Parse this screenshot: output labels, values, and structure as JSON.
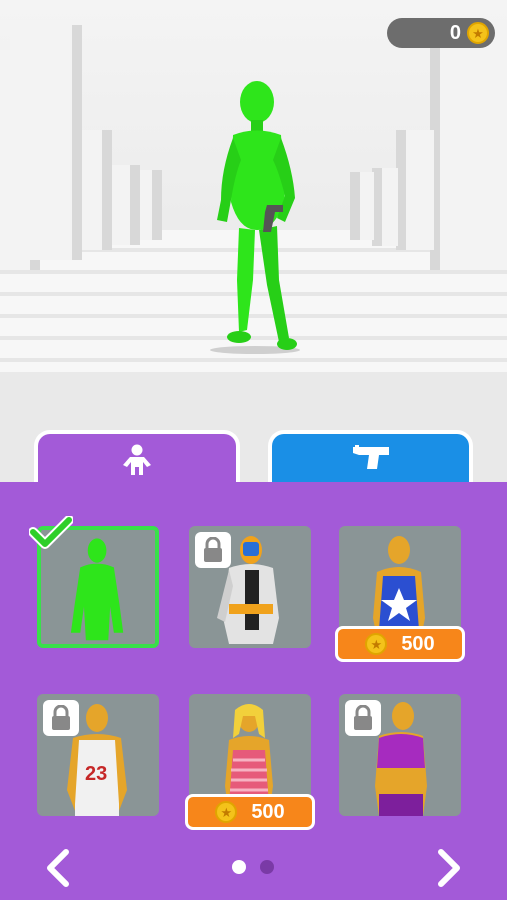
{
  "hud": {
    "coins": "0",
    "coin_icon": "coin-icon"
  },
  "tabs": [
    {
      "name": "skins",
      "icon": "person-icon",
      "active": true,
      "color": "#a35ad8"
    },
    {
      "name": "weapons",
      "icon": "pistol-icon",
      "active": false,
      "color": "#1a8fe6"
    }
  ],
  "shop": {
    "items": [
      {
        "skin": "green-stickman",
        "state": "selected"
      },
      {
        "skin": "armored-suit",
        "state": "locked"
      },
      {
        "skin": "blue-star-tank",
        "state": "price",
        "price": "500"
      },
      {
        "skin": "red-basketball-jersey",
        "state": "locked"
      },
      {
        "skin": "pink-striped-dress",
        "state": "price",
        "price": "500"
      },
      {
        "skin": "purple-crop-top",
        "state": "locked"
      }
    ]
  },
  "pager": {
    "current": 1,
    "total": 2
  },
  "colors": {
    "panel": "#a35ad8",
    "selected_border": "#39e04a",
    "price_button": "#f7861a",
    "character": "#2ee51b"
  }
}
